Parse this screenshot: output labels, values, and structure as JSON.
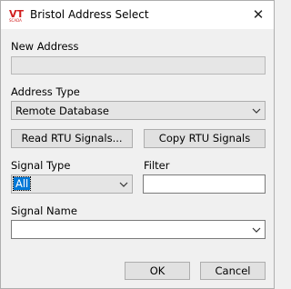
{
  "window": {
    "title": "Bristol Address Select",
    "app_icon": "vtscada-logo-icon",
    "close_glyph": "✕"
  },
  "new_address": {
    "label": "New Address",
    "value": ""
  },
  "address_type": {
    "label": "Address Type",
    "selected": "Remote Database"
  },
  "buttons": {
    "read_rtu": "Read RTU Signals...",
    "copy_rtu": "Copy RTU Signals",
    "ok": "OK",
    "cancel": "Cancel"
  },
  "signal_type": {
    "label": "Signal Type",
    "selected": "All"
  },
  "filter": {
    "label": "Filter",
    "value": ""
  },
  "signal_name": {
    "label": "Signal Name",
    "selected": ""
  }
}
